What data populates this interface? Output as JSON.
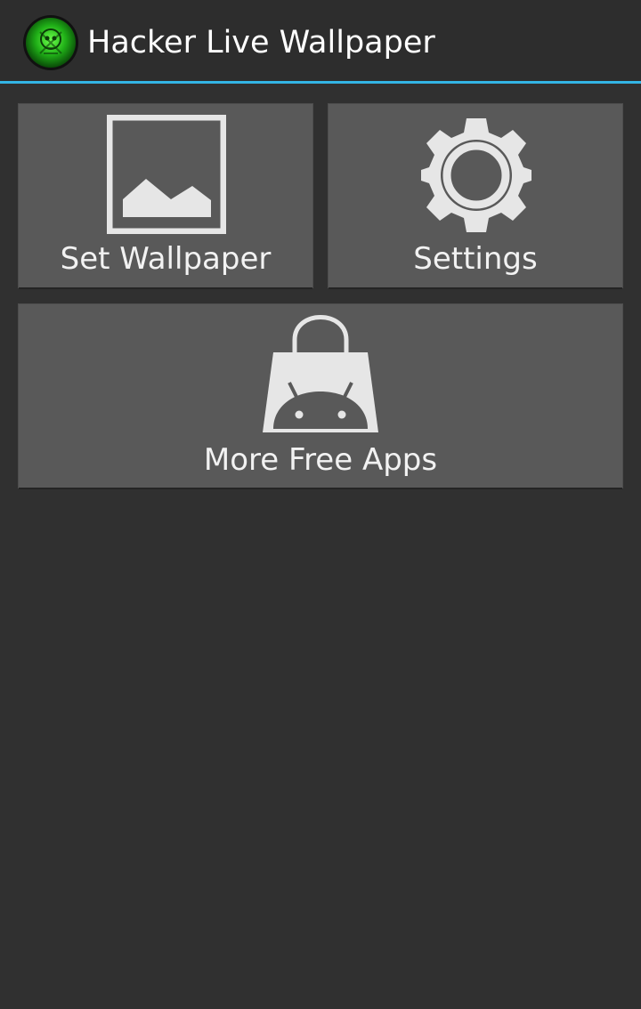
{
  "action_bar": {
    "title": "Hacker Live Wallpaper",
    "app_icon": "hacker-skull-app-icon",
    "accent_color": "#33b5e5"
  },
  "tiles": [
    {
      "label": "Set Wallpaper",
      "icon": "image-icon"
    },
    {
      "label": "Settings",
      "icon": "gear-icon"
    },
    {
      "label": "More Free Apps",
      "icon": "android-shopping-bag-icon"
    }
  ],
  "colors": {
    "background": "#303030",
    "tile": "#595959",
    "icon": "#e6e6e6"
  }
}
